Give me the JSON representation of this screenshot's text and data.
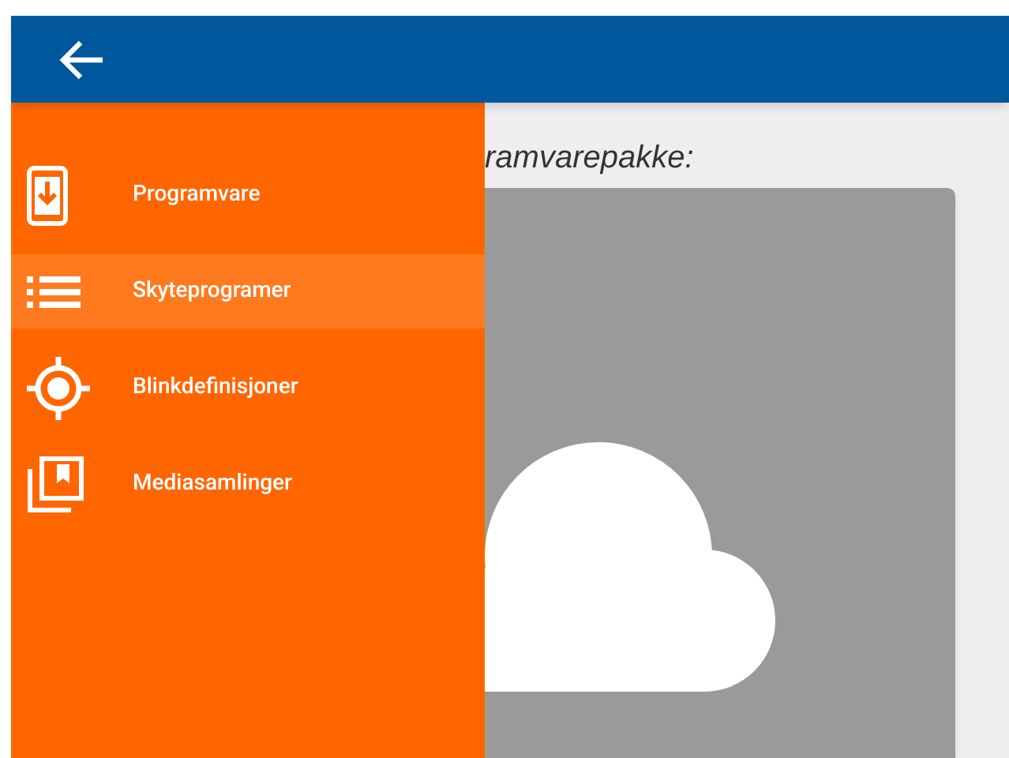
{
  "toolbar": {
    "back": true
  },
  "drawer": {
    "items": [
      {
        "kind": "download",
        "label": "Programvare",
        "selected": false
      },
      {
        "kind": "list",
        "label": "Skyteprogramer",
        "selected": true
      },
      {
        "kind": "target",
        "label": "Blinkdefinisjoner",
        "selected": false
      },
      {
        "kind": "media",
        "label": "Mediasamlinger",
        "selected": false
      }
    ]
  },
  "content": {
    "heading": "ramvarepakke:"
  }
}
